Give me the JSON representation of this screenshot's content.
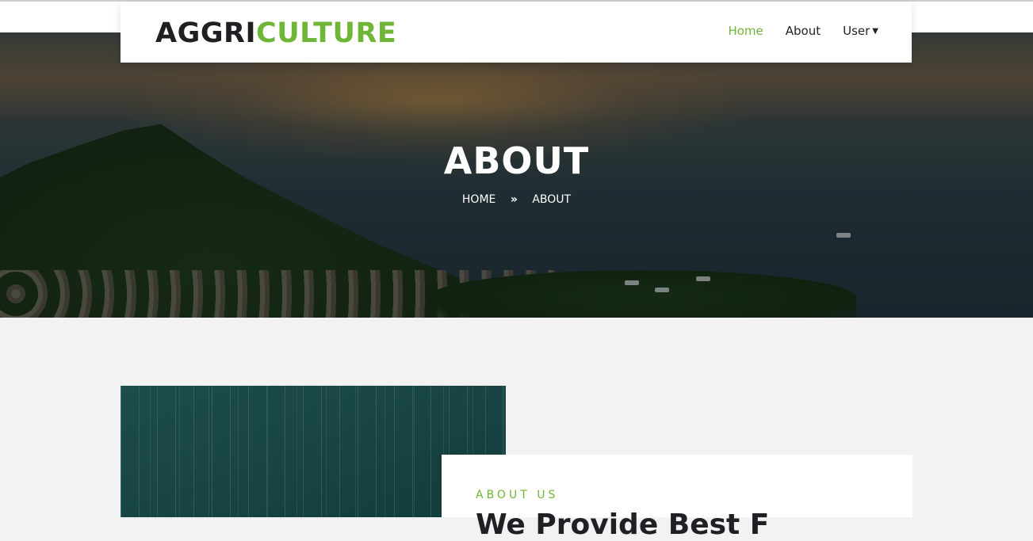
{
  "brand": {
    "logo_part1": "AGGRI",
    "logo_part2": "CULTURE",
    "green": "#6fb537",
    "dark": "#1f2024"
  },
  "nav": {
    "items": [
      {
        "label": "Home",
        "active": true
      },
      {
        "label": "About",
        "active": false
      },
      {
        "label": "User",
        "active": false,
        "has_dropdown": true
      }
    ]
  },
  "hero": {
    "title": "ABOUT",
    "breadcrumb": {
      "home": "HOME",
      "separator": "»",
      "current": "ABOUT"
    }
  },
  "about": {
    "label": "ABOUT US",
    "heading": "We Provide Best F"
  }
}
